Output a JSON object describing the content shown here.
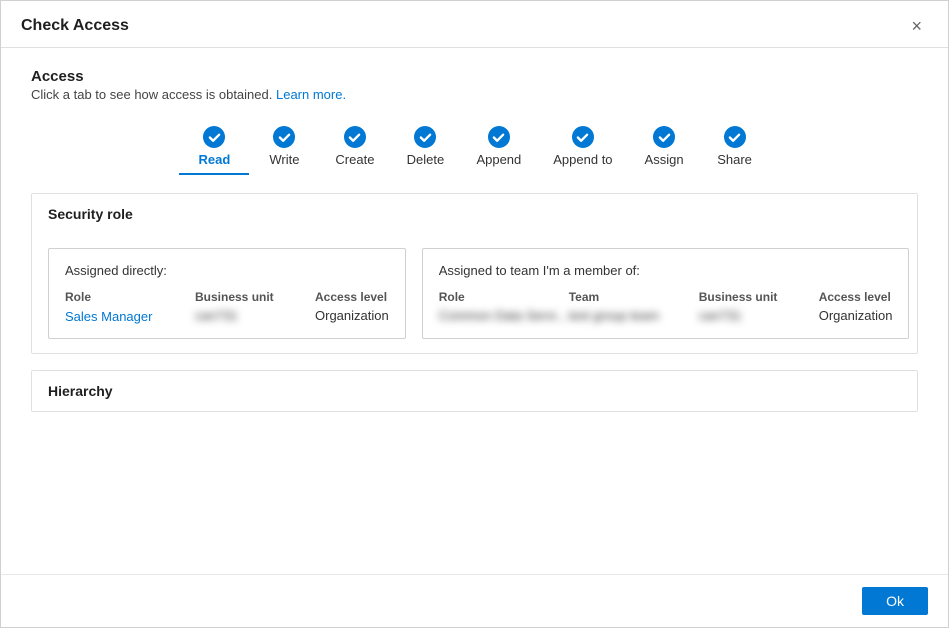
{
  "dialog": {
    "title": "Check Access",
    "close_label": "×"
  },
  "access": {
    "section_title": "Access",
    "description": "Click a tab to see how access is obtained.",
    "learn_more": "Learn more.",
    "tabs": [
      {
        "id": "read",
        "label": "Read",
        "active": true
      },
      {
        "id": "write",
        "label": "Write",
        "active": false
      },
      {
        "id": "create",
        "label": "Create",
        "active": false
      },
      {
        "id": "delete",
        "label": "Delete",
        "active": false
      },
      {
        "id": "append",
        "label": "Append",
        "active": false
      },
      {
        "id": "append-to",
        "label": "Append to",
        "active": false
      },
      {
        "id": "assign",
        "label": "Assign",
        "active": false
      },
      {
        "id": "share",
        "label": "Share",
        "active": false
      }
    ]
  },
  "security_role": {
    "section_title": "Security role",
    "assigned_directly": {
      "title": "Assigned directly:",
      "columns": {
        "role": "Role",
        "business_unit": "Business unit",
        "access_level": "Access level"
      },
      "rows": [
        {
          "role_prefix": "Sales",
          "role_suffix": " Manager",
          "business_unit": "can731",
          "access_level": "Organization"
        }
      ]
    },
    "assigned_to_team": {
      "title": "Assigned to team I'm a member of:",
      "columns": {
        "role": "Role",
        "team": "Team",
        "business_unit": "Business unit",
        "access_level": "Access level"
      },
      "rows": [
        {
          "role": "Common Data Servi...",
          "team": "test group team",
          "business_unit": "can731",
          "access_level": "Organization"
        }
      ]
    }
  },
  "hierarchy": {
    "section_title": "Hierarchy"
  },
  "footer": {
    "ok_label": "Ok"
  },
  "colors": {
    "accent": "#0078d4"
  }
}
